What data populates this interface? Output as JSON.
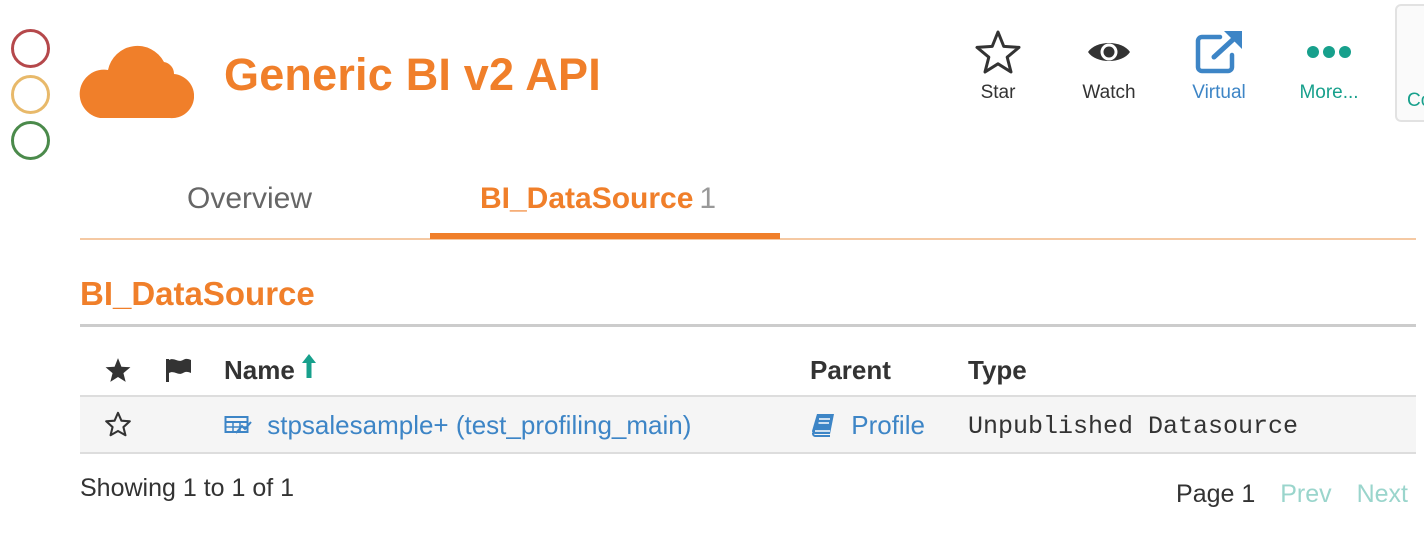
{
  "status_circles": [
    {
      "name": "red",
      "color": "#b5484b"
    },
    {
      "name": "yellow",
      "color": "#e8b96a"
    },
    {
      "name": "green",
      "color": "#4b8a4b"
    }
  ],
  "header": {
    "logo_icon": "cloud-icon",
    "title": "Generic BI v2 API",
    "accent_color": "#f07f2a",
    "actions": [
      {
        "label": "Star",
        "icon": "star-outline-icon"
      },
      {
        "label": "Watch",
        "icon": "eye-icon"
      },
      {
        "label": "Virtual",
        "icon": "external-link-icon"
      },
      {
        "label": "More...",
        "icon": "ellipsis-icon"
      }
    ],
    "side_panel_label": "Co"
  },
  "tabs": [
    {
      "label": "Overview",
      "active": false
    },
    {
      "label": "BI_DataSource",
      "count": "1",
      "active": true
    }
  ],
  "section": {
    "title": "BI_DataSource"
  },
  "table": {
    "columns": {
      "star_icon": "star-solid-icon",
      "flag_icon": "flag-icon",
      "name": "Name",
      "parent": "Parent",
      "type": "Type"
    },
    "rows": [
      {
        "starred": false,
        "name": "stpsalesample+ (test_profiling_main)",
        "name_icon": "datasource-table-icon",
        "parent": "Profile",
        "parent_icon": "book-icon",
        "type": "Unpublished Datasource"
      }
    ]
  },
  "footer": {
    "showing": "Showing 1 to 1 of 1",
    "page_label": "Page 1",
    "prev_label": "Prev",
    "next_label": "Next"
  }
}
